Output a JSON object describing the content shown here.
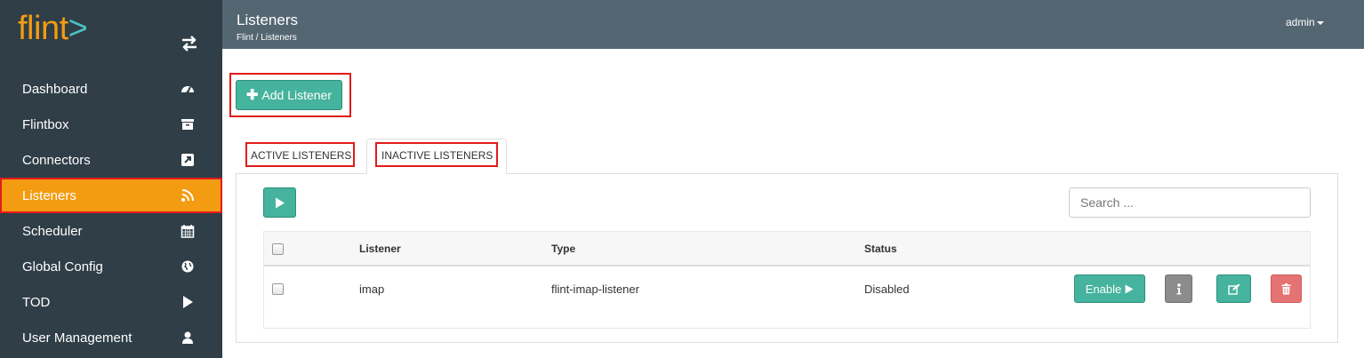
{
  "app": {
    "logo_text": "flint",
    "logo_accent": ">"
  },
  "sidebar": {
    "items": [
      {
        "label": "Dashboard",
        "icon": "dashboard-icon"
      },
      {
        "label": "Flintbox",
        "icon": "archive-icon"
      },
      {
        "label": "Connectors",
        "icon": "external-link-icon"
      },
      {
        "label": "Listeners",
        "icon": "rss-icon",
        "active": true
      },
      {
        "label": "Scheduler",
        "icon": "calendar-icon"
      },
      {
        "label": "Global Config",
        "icon": "globe-icon"
      },
      {
        "label": "TOD",
        "icon": "play-icon"
      },
      {
        "label": "User Management",
        "icon": "user-icon"
      }
    ]
  },
  "header": {
    "title": "Listeners",
    "breadcrumb": "Flint / Listeners",
    "user": "admin"
  },
  "toolbar": {
    "add_label": "Add Listener"
  },
  "tabs": [
    {
      "label": "ACTIVE LISTENERS",
      "selected": false
    },
    {
      "label": "INACTIVE LISTENERS",
      "selected": true
    }
  ],
  "search": {
    "placeholder": "Search ..."
  },
  "table": {
    "columns": [
      "Listener",
      "Type",
      "Status"
    ],
    "rows": [
      {
        "listener": "imap",
        "type": "flint-imap-listener",
        "status": "Disabled",
        "action_label": "Enable"
      }
    ]
  },
  "colors": {
    "sidebar_bg": "#2f3e47",
    "header_bg": "#546672",
    "accent_orange": "#f39c12",
    "teal": "#45b39d",
    "danger": "#e57373",
    "highlight_red": "#e21b1b"
  }
}
